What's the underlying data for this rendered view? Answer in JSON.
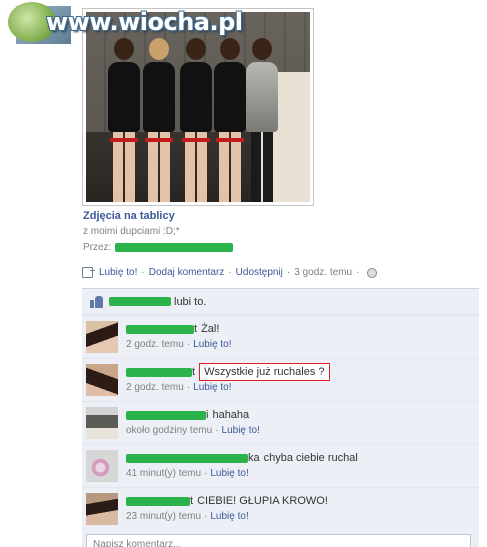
{
  "watermark": {
    "text": "www.wiocha.pl"
  },
  "post": {
    "caption_title": "Zdjęcia na tablicy",
    "caption_desc": "z moimi dupciami :D;*",
    "by_label": "Przez:"
  },
  "actions": {
    "like": "Lubię to!",
    "comment": "Dodaj komentarz",
    "share": "Udostępnij",
    "time": "3 godz. temu",
    "sep": "·"
  },
  "likes": {
    "text": "lubi to."
  },
  "comments": [
    {
      "name_suffix": "t",
      "text": "Żal!",
      "time": "2 godz. temu",
      "like": "Lubię to!"
    },
    {
      "name_suffix": "t",
      "text": "Wszystkie już ruchales ?",
      "time": "2 godz. temu",
      "like": "Lubię to!"
    },
    {
      "name_suffix": "i",
      "text": "hahaha",
      "time": "około godziny temu",
      "like": "Lubię to!"
    },
    {
      "name_suffix": "ka",
      "text": "chyba ciebie ruchal",
      "time": "41 minut(y) temu",
      "like": "Lubię to!"
    },
    {
      "name_suffix": "t",
      "text": "CIEBIE! GŁUPIA KROWO!",
      "time": "23 minut(y) temu",
      "like": "Lubię to!"
    }
  ],
  "write_comment": {
    "placeholder": "Napisz komentarz..."
  },
  "colors": {
    "link": "#3b5998",
    "censor": "#2bb34b",
    "highlight_border": "#e02020"
  }
}
